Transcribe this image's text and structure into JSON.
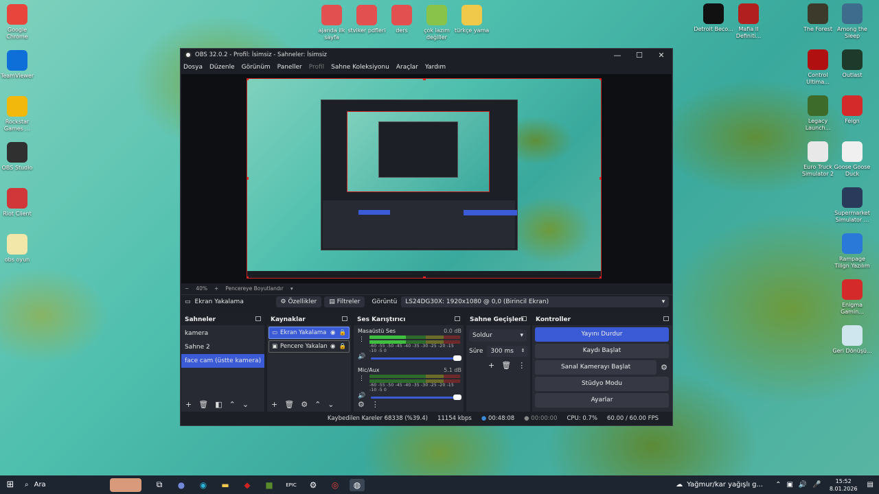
{
  "desktop": {
    "left_icons": [
      {
        "label": "Google Chrome",
        "color": "#e8453c"
      },
      {
        "label": "TeamViewer",
        "color": "#0e6fd8"
      },
      {
        "label": "Rockstar Games ...",
        "color": "#f2b90c"
      },
      {
        "label": "OBS Studio",
        "color": "#303030"
      },
      {
        "label": "Riot Client",
        "color": "#d13639"
      },
      {
        "label": "obs oyun",
        "color": "#f3e6a9"
      }
    ],
    "top_icons": [
      {
        "label": "ajanda ilk sayfa",
        "color": "#e35050"
      },
      {
        "label": "stviker pdfleri",
        "color": "#e35050"
      },
      {
        "label": "ders",
        "color": "#e35050"
      },
      {
        "label": "çok lazım değiller",
        "color": "#8ac34a"
      },
      {
        "label": "türkçe yama",
        "color": "#f0c94a"
      }
    ],
    "right_icons_a": [
      {
        "label": "Detroit Beco...",
        "color": "#111111"
      },
      {
        "label": "Mafia II Definiti...",
        "color": "#b21f1f"
      }
    ],
    "right_icons_b": [
      {
        "label": "The Forest",
        "color": "#3c3a2a"
      },
      {
        "label": "Control Ultima...",
        "color": "#b01010"
      },
      {
        "label": "Legacy Launch...",
        "color": "#3d6b2a"
      },
      {
        "label": "Euro Truck Simulator 2",
        "color": "#e8e8e8"
      }
    ],
    "right_icons_c": [
      {
        "label": "Among the Sleep",
        "color": "#3e6c8c"
      },
      {
        "label": "Outlast",
        "color": "#1e3a2a"
      },
      {
        "label": "Feign",
        "color": "#d42a2a"
      },
      {
        "label": "Goose Goose Duck",
        "color": "#f0f0f0"
      },
      {
        "label": "Supermarket Simulator ...",
        "color": "#2a3a5a"
      },
      {
        "label": "Rampage Tilign Yazılım",
        "color": "#2a78d8"
      },
      {
        "label": "Enigma Gamin...",
        "color": "#d42a2a"
      },
      {
        "label": "Geri Dönüşü...",
        "color": "#cfe6ef"
      }
    ]
  },
  "obs": {
    "title": "OBS 32.0.2 - Profil: İsimsiz - Sahneler: İsimsiz",
    "menu": [
      "Dosya",
      "Düzenle",
      "Görünüm",
      "Paneller",
      "Profil",
      "Sahne Koleksiyonu",
      "Araçlar",
      "Yardım"
    ],
    "zoom": {
      "minus": "−",
      "percent": "40%",
      "plus": "+",
      "fit": "Pencereye Boyutlandır"
    },
    "source_bar": {
      "source": "Ekran Yakalama",
      "properties": "Özellikler",
      "filters": "Filtreler",
      "display_label": "Görüntü",
      "display_value": "LS24DG30X: 1920x1080 @ 0,0 (Birincil Ekran)"
    },
    "scenes": {
      "title": "Sahneler",
      "items": [
        "kamera",
        "Sahne 2",
        "face cam (üstte kamera)"
      ],
      "selected": 2
    },
    "sources": {
      "title": "Kaynaklar",
      "items": [
        "Ekran Yakalama",
        "Pencere Yakalan"
      ]
    },
    "mixer": {
      "title": "Ses Karıştırıcı",
      "channels": [
        {
          "name": "Masaüstü Ses",
          "db": "0.0 dB"
        },
        {
          "name": "Mic/Aux",
          "db": "5.1 dB"
        }
      ],
      "scale": "-60 -55 -50 -45 -40 -35 -30 -25 -20 -15 -10 -5 0"
    },
    "transitions": {
      "title": "Sahne Geçişleri",
      "type": "Soldur",
      "duration_label": "Süre",
      "duration": "300 ms"
    },
    "controls": {
      "title": "Kontroller",
      "buttons": [
        "Yayını Durdur",
        "Kaydı Başlat",
        "Sanal Kamerayı Başlat",
        "Stüdyo Modu",
        "Ayarlar"
      ]
    },
    "status": {
      "dropped": "Kaybedilen Kareler 68338 (%39.4)",
      "bitrate": "11154 kbps",
      "stream_time": "00:48:08",
      "rec_time": "00:00:00",
      "cpu": "CPU: 0.7%",
      "fps": "60.00 / 60.00 FPS"
    }
  },
  "taskbar": {
    "search": "Ara",
    "weather": "Yağmur/kar yağışlı g...",
    "time": "15:52",
    "date": "8.01.2026"
  }
}
